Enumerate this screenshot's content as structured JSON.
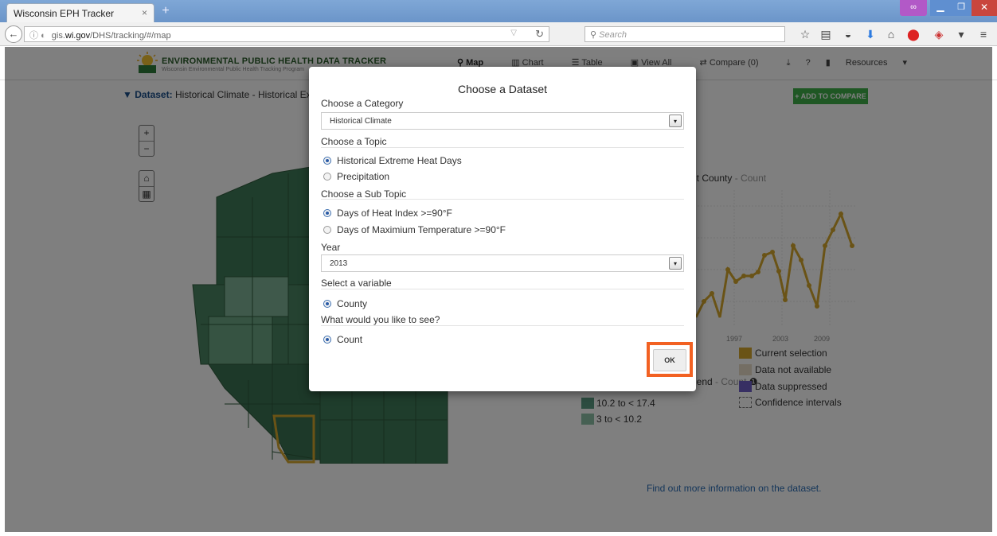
{
  "browser": {
    "tab_title": "Wisconsin EPH Tracker",
    "tab_close": "×",
    "new_tab": "+",
    "url_prefix": "gis.",
    "url_domain": "wi.gov",
    "url_path": "/DHS/tracking/#/map",
    "search_placeholder": "Search"
  },
  "site": {
    "title": "ENVIRONMENTAL PUBLIC HEALTH DATA TRACKER",
    "subtitle": "Wisconsin Environmental Public Health Tracking Program",
    "nav": {
      "map": "Map",
      "chart": "Chart",
      "table": "Table",
      "view_all": "View All",
      "compare": "Compare (0)",
      "help": "?",
      "resources": "Resources"
    }
  },
  "dataset": {
    "label": "Dataset:",
    "value": "Historical Climate - Historical Extre"
  },
  "add_to_compare": "+ ADD TO COMPARE",
  "chart": {
    "label": "nt County",
    "sub": "- Count",
    "x_ticks": [
      "1997",
      "2003",
      "2009"
    ],
    "line_color": "#d4a72c"
  },
  "legend": {
    "title": "gend",
    "sub": "- Count",
    "right": [
      "Current selection",
      "Data not available",
      "Data suppressed",
      "Confidence intervals"
    ],
    "left": [
      "10.2 to < 17.4",
      "3 to < 10.2"
    ],
    "colors": {
      "current_selection": "#d4a72c",
      "not_available": "#e8ddc9",
      "suppressed": "#6f5fc6",
      "range_1": "#5b9b83",
      "range_2": "#8cc0a6"
    }
  },
  "more_info": "Find out more information on the dataset.",
  "modal": {
    "title": "Choose a Dataset",
    "category_label": "Choose a Category",
    "category_value": "Historical Climate",
    "topic_label": "Choose a Topic",
    "topics": [
      "Historical Extreme Heat Days",
      "Precipitation"
    ],
    "subtopic_label": "Choose a Sub Topic",
    "subtopics": [
      "Days of Heat Index >=90°F",
      "Days of Maximium Temperature >=90°F"
    ],
    "year_label": "Year",
    "year_value": "2013",
    "variable_label": "Select a variable",
    "variable": "County",
    "see_label": "What would you like to see?",
    "see": "Count",
    "ok": "OK"
  }
}
